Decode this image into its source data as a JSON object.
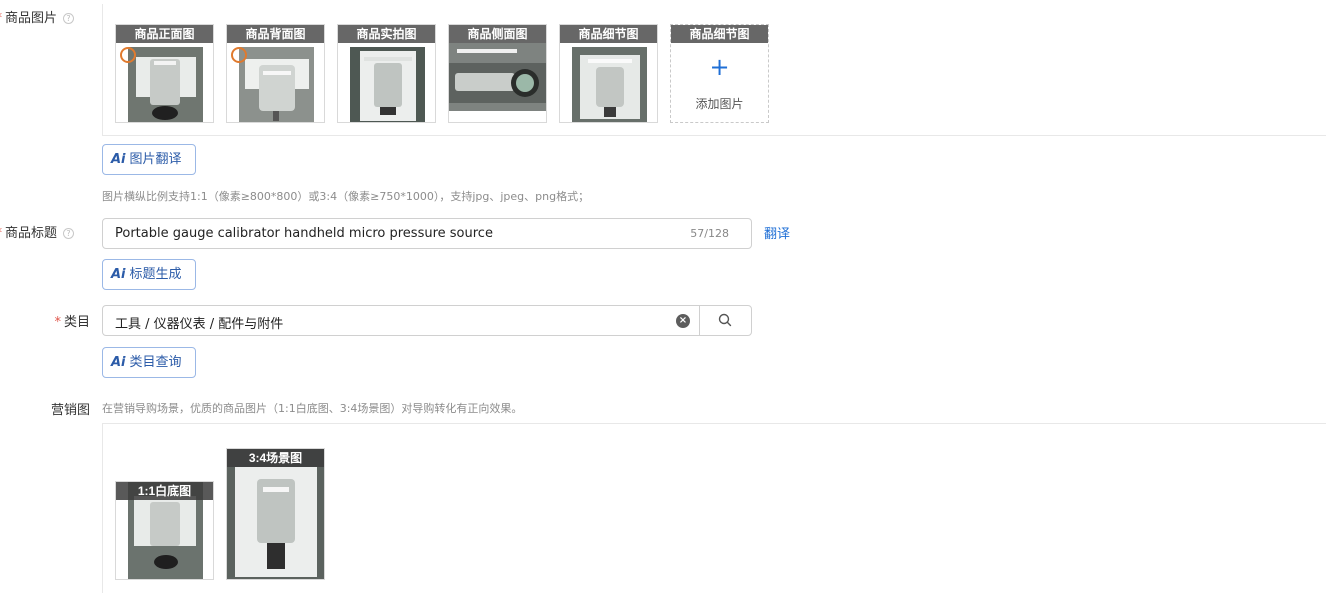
{
  "product_images": {
    "label": "商品图片",
    "images": [
      {
        "caption": "商品正面图",
        "tone": "#6a716c"
      },
      {
        "caption": "商品背面图",
        "tone": "#8a8f8a"
      },
      {
        "caption": "商品实拍图",
        "tone": "#4f5a55"
      },
      {
        "caption": "商品侧面图",
        "tone": "#7a7f7c"
      },
      {
        "caption": "商品细节图",
        "tone": "#666e69"
      }
    ],
    "add_slot": {
      "caption": "商品细节图",
      "plus": "+",
      "label": "添加图片"
    },
    "ai_button": "图片翻译",
    "hint": "图片横纵比例支持1:1（像素≥800*800）或3:4（像素≥750*1000），支持jpg、jpeg、png格式；"
  },
  "title": {
    "label": "商品标题",
    "value": "Portable  gauge calibrator handheld micro pressure source",
    "count": "57/128",
    "translate_link": "翻译",
    "ai_button": "标题生成"
  },
  "category": {
    "label": "类目",
    "value": "工具 / 仪器仪表 / 配件与附件",
    "ai_button": "类目查询"
  },
  "marketing": {
    "label": "营销图",
    "hint": "在营销导购场景，优质的商品图片（1:1白底图、3:4场景图）对导购转化有正向效果。",
    "images": [
      {
        "caption": "1:1白底图"
      },
      {
        "caption": "3:4场景图"
      }
    ]
  },
  "ai_prefix": "Ai",
  "required_mark": "*",
  "help_mark": "?",
  "colors": {
    "accent": "#1f6fd6",
    "required": "#e0564b",
    "ai_border": "#9bb8e6"
  }
}
